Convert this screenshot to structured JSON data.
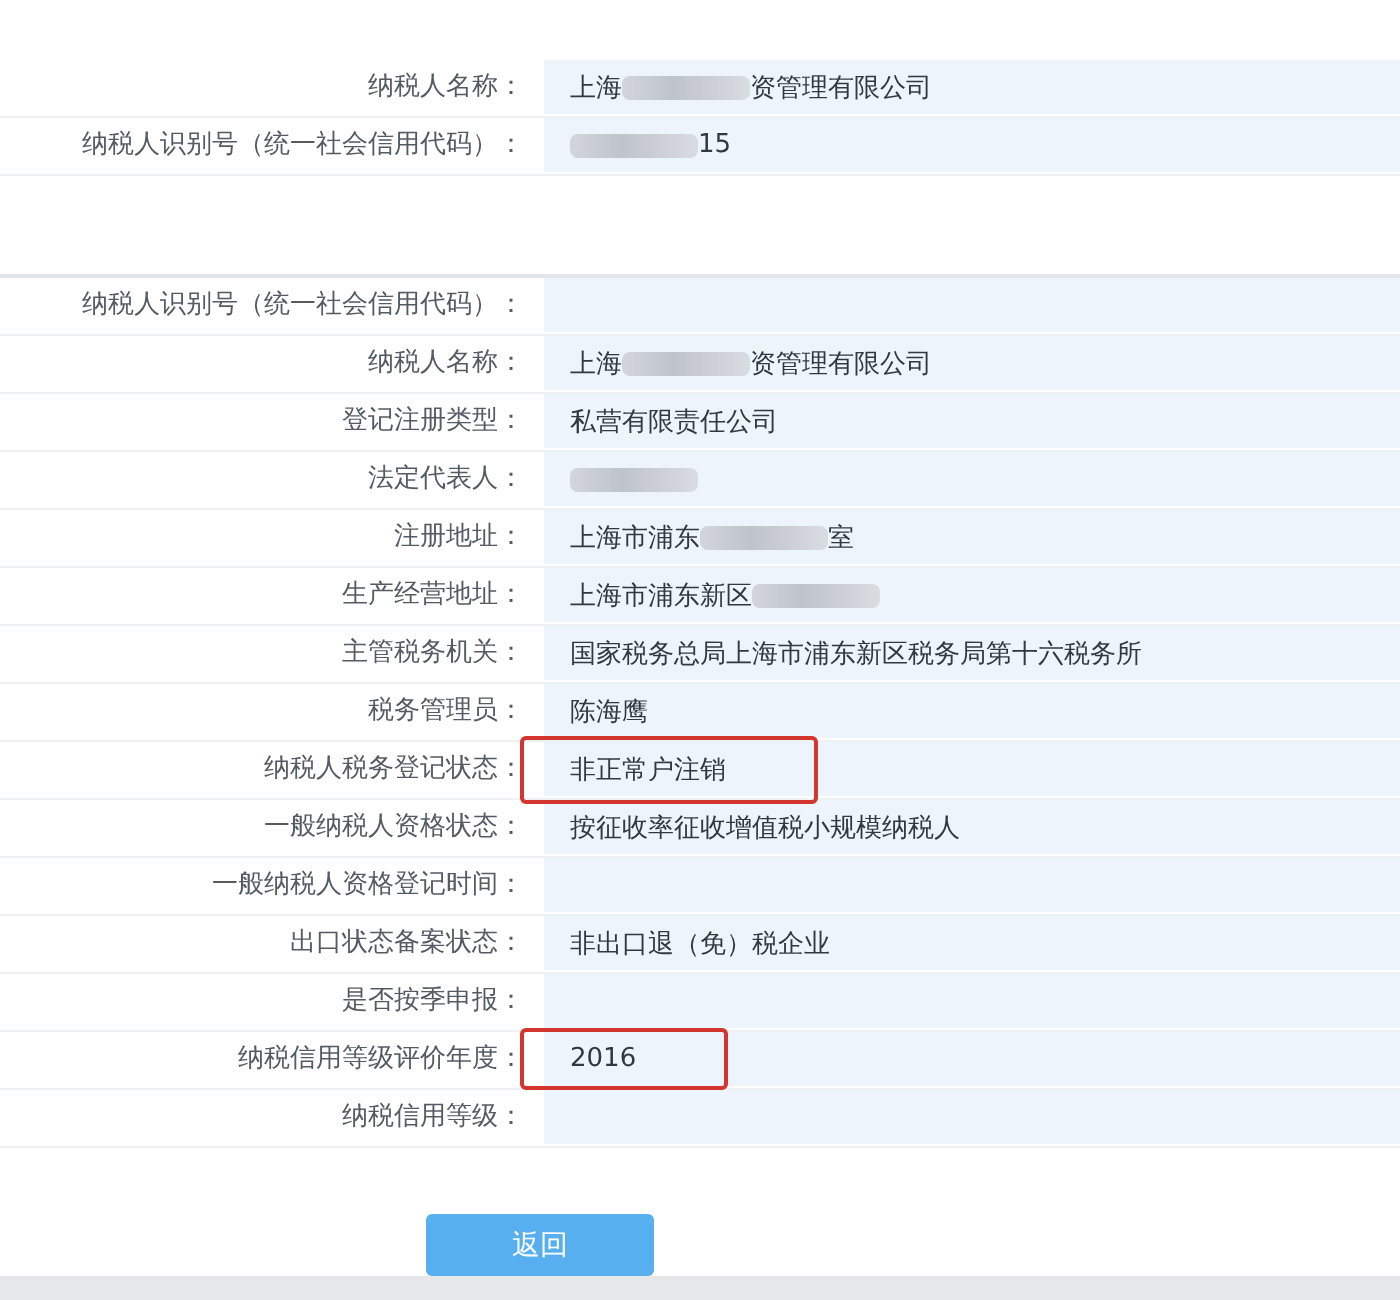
{
  "section_1": {
    "rows": [
      {
        "label": "纳税人名称：",
        "value_parts": [
          {
            "kind": "text",
            "text": "上海"
          },
          {
            "kind": "redacted"
          },
          {
            "kind": "text",
            "text": "资管理有限公司"
          }
        ],
        "highlighted": false
      },
      {
        "label": "纳税人识别号（统一社会信用代码）：",
        "value_parts": [
          {
            "kind": "redacted"
          },
          {
            "kind": "text",
            "text": "15"
          }
        ],
        "highlighted": false
      }
    ]
  },
  "section_2": {
    "rows": [
      {
        "label": "纳税人识别号（统一社会信用代码）：",
        "highlighted": false
      },
      {
        "label": "纳税人名称：",
        "value_parts": [
          {
            "kind": "text",
            "text": "上海"
          },
          {
            "kind": "redacted"
          },
          {
            "kind": "text",
            "text": "资管理有限公司"
          }
        ],
        "highlighted": false
      },
      {
        "label": "登记注册类型：",
        "value_parts": [
          {
            "kind": "text",
            "text": "私营有限责任公司"
          }
        ],
        "highlighted": false
      },
      {
        "label": "法定代表人：",
        "value_parts": [
          {
            "kind": "redacted"
          }
        ],
        "highlighted": false
      },
      {
        "label": "注册地址：",
        "value_parts": [
          {
            "kind": "text",
            "text": "上海市浦东"
          },
          {
            "kind": "redacted"
          },
          {
            "kind": "text",
            "text": "室"
          }
        ],
        "highlighted": false
      },
      {
        "label": "生产经营地址：",
        "value_parts": [
          {
            "kind": "text",
            "text": "上海市浦东新区"
          },
          {
            "kind": "redacted"
          }
        ],
        "highlighted": false
      },
      {
        "label": "主管税务机关：",
        "value_parts": [
          {
            "kind": "text",
            "text": "国家税务总局上海市浦东新区税务局第十六税务所"
          }
        ],
        "highlighted": false
      },
      {
        "label": "税务管理员：",
        "value_parts": [
          {
            "kind": "text",
            "text": "陈海鹰"
          }
        ],
        "highlighted": false
      },
      {
        "label": "纳税人税务登记状态：",
        "value_parts": [
          {
            "kind": "text",
            "text": "非正常户注销"
          }
        ],
        "highlighted": true
      },
      {
        "label": "一般纳税人资格状态：",
        "value_parts": [
          {
            "kind": "text",
            "text": "按征收率征收增值税小规模纳税人"
          }
        ],
        "highlighted": false
      },
      {
        "label": "一般纳税人资格登记时间：",
        "highlighted": false
      },
      {
        "label": "出口状态备案状态：",
        "value_parts": [
          {
            "kind": "text",
            "text": "非出口退（免）税企业"
          }
        ],
        "highlighted": false
      },
      {
        "label": "是否按季申报：",
        "highlighted": false
      },
      {
        "label": "纳税信用等级评价年度：",
        "value_parts": [
          {
            "kind": "text",
            "text": "2016"
          }
        ],
        "highlighted": true
      },
      {
        "label": "纳税信用等级：",
        "highlighted": false
      }
    ]
  },
  "buttons": [
    {
      "label": "返回"
    }
  ]
}
